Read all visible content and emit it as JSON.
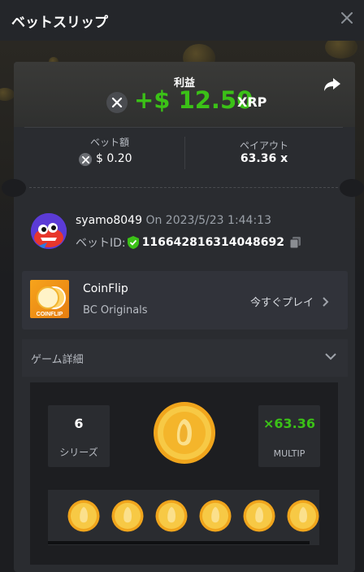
{
  "header": {
    "title": "ベットスリップ"
  },
  "profit": {
    "label": "利益",
    "amount": "+$ 12.50",
    "currency": "XRP"
  },
  "bet": {
    "amount_label": "ベット額",
    "amount_value": "$ 0.20",
    "payout_label": "ペイアウト",
    "payout_value": "63.36 x"
  },
  "user": {
    "name": "syamo8049",
    "date": "On 2023/5/23 1:44:13",
    "bet_id_label": "ベットID:",
    "bet_id": "116642816314048692"
  },
  "game": {
    "logo_text": "COINFLIP",
    "name": "CoinFlip",
    "provider": "BC Originals",
    "play_label": "今すぐプレイ"
  },
  "details": {
    "label": "ゲーム詳細",
    "series_count": "6",
    "series_label": "シリーズ",
    "multiplier": "63.36",
    "multiplier_prefix": "×",
    "multiplier_label": "MULTIP"
  },
  "colors": {
    "profit_green": "#3bc117",
    "coin_gold": "#f5b82a"
  },
  "icons": [
    "close-icon",
    "xrp-icon",
    "share-icon",
    "shield-check-icon",
    "copy-icon",
    "chevron-right-icon",
    "chevron-down-icon",
    "coin-icon"
  ]
}
